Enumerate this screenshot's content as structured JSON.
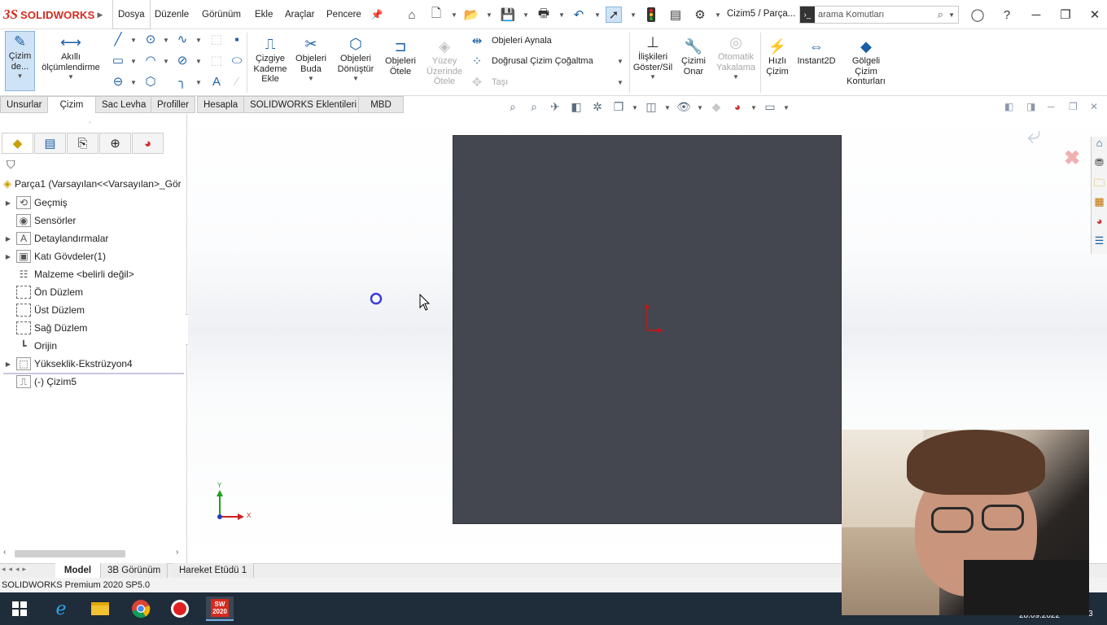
{
  "app": {
    "brand": "SOLIDWORKS",
    "document_title": "Cizim5 / Parça...",
    "status": "SOLIDWORKS Premium 2020 SP5.0"
  },
  "menu": [
    "Dosya",
    "Düzenle",
    "Görünüm",
    "Ekle",
    "Araçlar",
    "Pencere"
  ],
  "search": {
    "placeholder": "arama Komutları"
  },
  "ribbon": {
    "sketch": "Çizim de...",
    "smart_dim": "Akıllı ölçümlendirme",
    "offset_entities": "Çizgiye Kademe Ekle",
    "trim": "Objeleri Buda",
    "convert": "Objeleri Dönüştür",
    "offset": "Objeleri Ötele",
    "offset_surface": "Yüzey Üzerinde Ötele",
    "mirror": "Objeleri Aynala",
    "linear_pattern": "Doğrusal Çizim Çoğaltma",
    "move": "Taşı",
    "relations": "İlişkileri Göster/Sil",
    "repair": "Çizimi Onar",
    "snap": "Otomatik Yakalama",
    "rapid": "Hızlı Çizim",
    "instant2d": "Instant2D",
    "shaded": "Gölgeli Çizim Konturları"
  },
  "tabs": [
    "Unsurlar",
    "Çizim",
    "Sac Levha",
    "Profiller",
    "Hesapla",
    "SOLIDWORKS Eklentileri",
    "MBD"
  ],
  "tree": {
    "root": "Parça1  (Varsayılan<<Varsayılan>_Gör",
    "items": [
      {
        "label": "Geçmiş",
        "icon": "history-icon",
        "expandable": true
      },
      {
        "label": "Sensörler",
        "icon": "sensor-icon",
        "expandable": false
      },
      {
        "label": "Detaylandırmalar",
        "icon": "annotation-icon",
        "expandable": true
      },
      {
        "label": "Katı Gövdeler(1)",
        "icon": "solid-body-icon",
        "expandable": true
      },
      {
        "label": "Malzeme <belirli değil>",
        "icon": "material-icon",
        "expandable": false
      },
      {
        "label": "Ön Düzlem",
        "icon": "plane-icon",
        "expandable": false
      },
      {
        "label": "Üst Düzlem",
        "icon": "plane-icon",
        "expandable": false
      },
      {
        "label": "Sağ Düzlem",
        "icon": "plane-icon",
        "expandable": false
      },
      {
        "label": "Orijin",
        "icon": "origin-icon",
        "expandable": false
      },
      {
        "label": "Yükseklik-Ekstrüzyon4",
        "icon": "extrude-icon",
        "expandable": true
      },
      {
        "label": "(-) Çizim5",
        "icon": "sketch-icon",
        "expandable": false
      }
    ]
  },
  "bottom_tabs": [
    "Model",
    "3B Görünüm",
    "Hareket Etüdü 1"
  ],
  "triad": {
    "x": "X",
    "y": "Y"
  },
  "taskbar": {
    "date": "28.09.2022",
    "notification_count": "3",
    "sw_badge": "2020"
  }
}
